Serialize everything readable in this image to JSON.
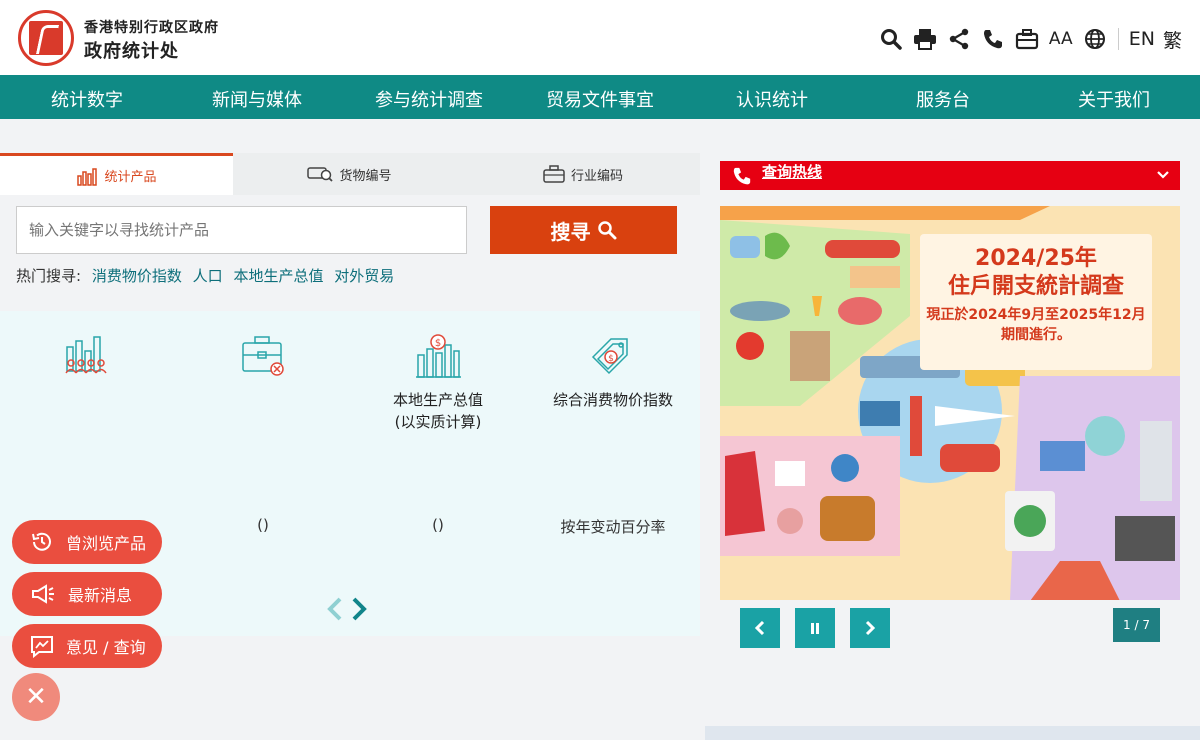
{
  "header": {
    "org_line1": "香港特别行政区政府",
    "org_line2": "政府统计处",
    "lang_en": "EN",
    "lang_trad": "繁",
    "font_size": "AA"
  },
  "nav": {
    "items": [
      "统计数字",
      "新闻与媒体",
      "参与统计调查",
      "贸易文件事宜",
      "认识统计",
      "服务台",
      "关于我们"
    ]
  },
  "search_panel": {
    "tabs": [
      "统计产品",
      "货物编号",
      "行业编码"
    ],
    "placeholder": "输入关键字以寻找统计产品",
    "button_label": "搜寻",
    "hot_label": "热门搜寻:",
    "hot_links": [
      "消费物价指数",
      "人口",
      "本地生产总值",
      "对外贸易"
    ]
  },
  "cards": [
    {
      "title": "",
      "value": ""
    },
    {
      "title": "",
      "value": "()"
    },
    {
      "title": "本地生产总值\n(以实质计算)",
      "value": "()"
    },
    {
      "title": "综合消费物价指数",
      "value": "按年变动百分率"
    }
  ],
  "floating": {
    "history": "曾浏览产品",
    "news": "最新消息",
    "feedback": "意见 / 查询"
  },
  "hotline": {
    "label": "查询热线"
  },
  "banner": {
    "line1": "2024/25年",
    "line2": "住戶開支統計調查",
    "line3": "現正於2024年9月至2025年12月",
    "line4": "期間進行。"
  },
  "carousel": {
    "counter": "1 / 7"
  },
  "colors": {
    "teal": "#0f8a85",
    "accent": "#d9410f",
    "red": "#e60012"
  }
}
